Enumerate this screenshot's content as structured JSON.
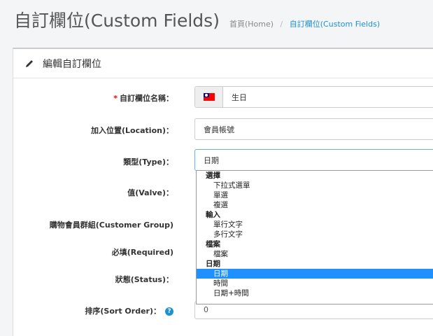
{
  "header": {
    "title": "自訂欄位(Custom Fields)",
    "breadcrumb": [
      {
        "label": "首頁(Home)"
      },
      {
        "label": "自訂欄位(Custom Fields)"
      }
    ],
    "breadcrumb_separator": "/"
  },
  "panel": {
    "heading": "編輯自訂欄位",
    "heading_icon": "pencil-icon"
  },
  "form": {
    "name": {
      "required_mark": "*",
      "label": "自訂欄位名稱：",
      "value": "生日",
      "flag_icon": "taiwan-flag-icon"
    },
    "location": {
      "label": "加入位置(Location)：",
      "value": "會員帳號"
    },
    "type": {
      "label": "類型(Type)：",
      "value": "日期"
    },
    "value": {
      "label": "值(Valve)："
    },
    "customer_group": {
      "label": "購物會員群組(Customer Group)"
    },
    "required": {
      "label": "必填(Required)"
    },
    "status": {
      "label": "狀態(Status)："
    },
    "sort_order": {
      "label": "排序(Sort Order)：",
      "help_icon": "?",
      "value": "0"
    }
  },
  "type_dropdown": {
    "groups": [
      {
        "label": "選擇",
        "options": [
          "下拉式選單",
          "單選",
          "複選"
        ]
      },
      {
        "label": "輸入",
        "options": [
          "單行文字",
          "多行文字"
        ]
      },
      {
        "label": "檔案",
        "options": [
          "檔案"
        ]
      },
      {
        "label": "日期",
        "options": [
          "日期",
          "時間",
          "日期+時間"
        ]
      }
    ],
    "selected": "日期"
  },
  "colors": {
    "accent": "#1e91cf",
    "selected_option": "#1e90ff",
    "required": "#ff0000"
  }
}
